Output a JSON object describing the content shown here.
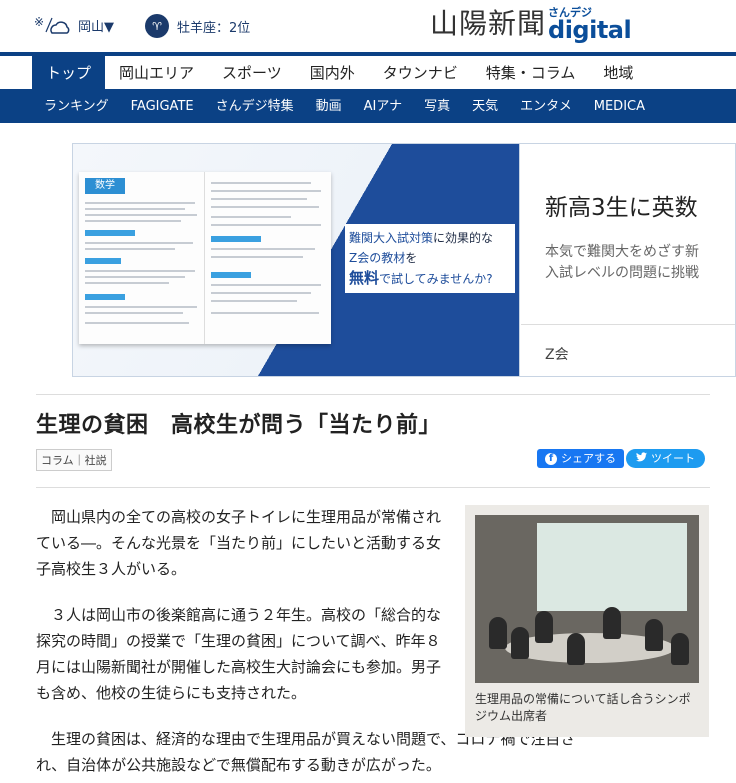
{
  "header": {
    "weather_location": "岡山▼",
    "horoscope": "牡羊座：2位",
    "logo_jp": "山陽新聞",
    "logo_small": "さんデジ",
    "logo_digital": "digital"
  },
  "nav_primary": [
    "トップ",
    "岡山エリア",
    "スポーツ",
    "国内外",
    "タウンナビ",
    "特集・コラム",
    "地域"
  ],
  "nav_secondary": [
    "ランキング",
    "FAGIGATE",
    "さんデジ特集",
    "動画",
    "AIアナ",
    "写真",
    "天気",
    "エンタメ",
    "MEDICA"
  ],
  "ad": {
    "book_tag": "数学",
    "copy_line1a": "難関大入試対策",
    "copy_line1b": "に効果的な",
    "copy_line2a": "Z会の教材",
    "copy_line2b": "を",
    "copy_free": "無料",
    "copy_line3": "で試してみませんか?",
    "headline": "新高3生に英数",
    "sub1": "本気で難関大をめざす新",
    "sub2": "入試レベルの問題に挑戦",
    "brand": "Z会"
  },
  "article": {
    "title": "生理の貧困　高校生が問う「当たり前」",
    "tags": "コラム｜社説",
    "share_label": "シェアする",
    "tweet_label": "ツイート",
    "paragraphs": [
      "岡山県内の全ての高校の女子トイレに生理用品が常備されている―。そんな光景を「当たり前」にしたいと活動する女子高校生３人がいる。",
      "３人は岡山市の後楽館高に通う２年生。高校の「総合的な探究の時間」の授業で「生理の貧困」について調べ、昨年８月には山陽新聞社が開催した高校生大討論会にも参加。男子も含め、他校の生徒らにも支持された。",
      "生理の貧困は、経済的な理由で生理用品が買えない問題で、コロナ禍で注目され、自治体が公共施設などで無償配布する動きが広がった。"
    ],
    "photo_caption": "生理用品の常備について話し合うシンポジウム出席者"
  },
  "colors": {
    "navy": "#0b4185",
    "facebook": "#1877f2",
    "twitter": "#1d9bf0"
  }
}
